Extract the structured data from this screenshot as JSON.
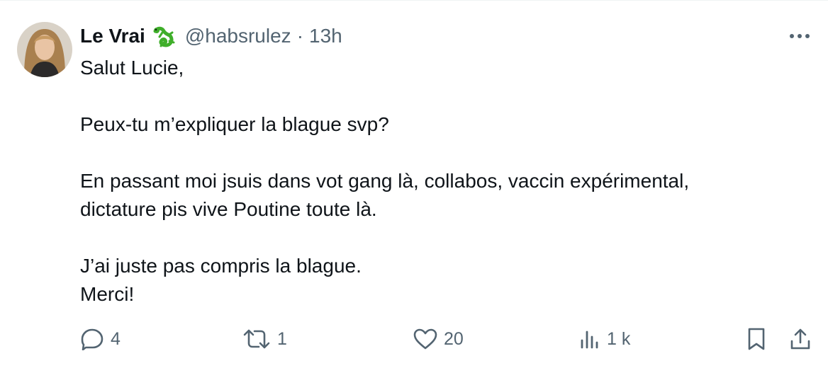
{
  "author": {
    "display_name": "Le Vrai",
    "emoji": "lizard-emoji",
    "handle": "@habsrulez",
    "separator": "·",
    "timestamp": "13h"
  },
  "tweet": {
    "lines": [
      "Salut Lucie,",
      "",
      "Peux-tu m’expliquer la blague svp?",
      "",
      "En passant moi jsuis dans vot gang là, collabos, vaccin expérimental,",
      "dictature pis vive Poutine toute là.",
      "",
      "J’ai juste pas compris la blague.",
      "Merci!"
    ]
  },
  "actions": {
    "replies": "4",
    "reposts": "1",
    "likes": "20",
    "views": "1 k"
  },
  "icons": {
    "more": "more-horizontal-icon",
    "reply": "reply-icon",
    "repost": "repost-icon",
    "like": "heart-icon",
    "views": "views-chart-icon",
    "bookmark": "bookmark-icon",
    "share": "share-icon"
  },
  "colors": {
    "text": "#0f1419",
    "secondary": "#536471",
    "lizard_green": "#3fae2a"
  }
}
